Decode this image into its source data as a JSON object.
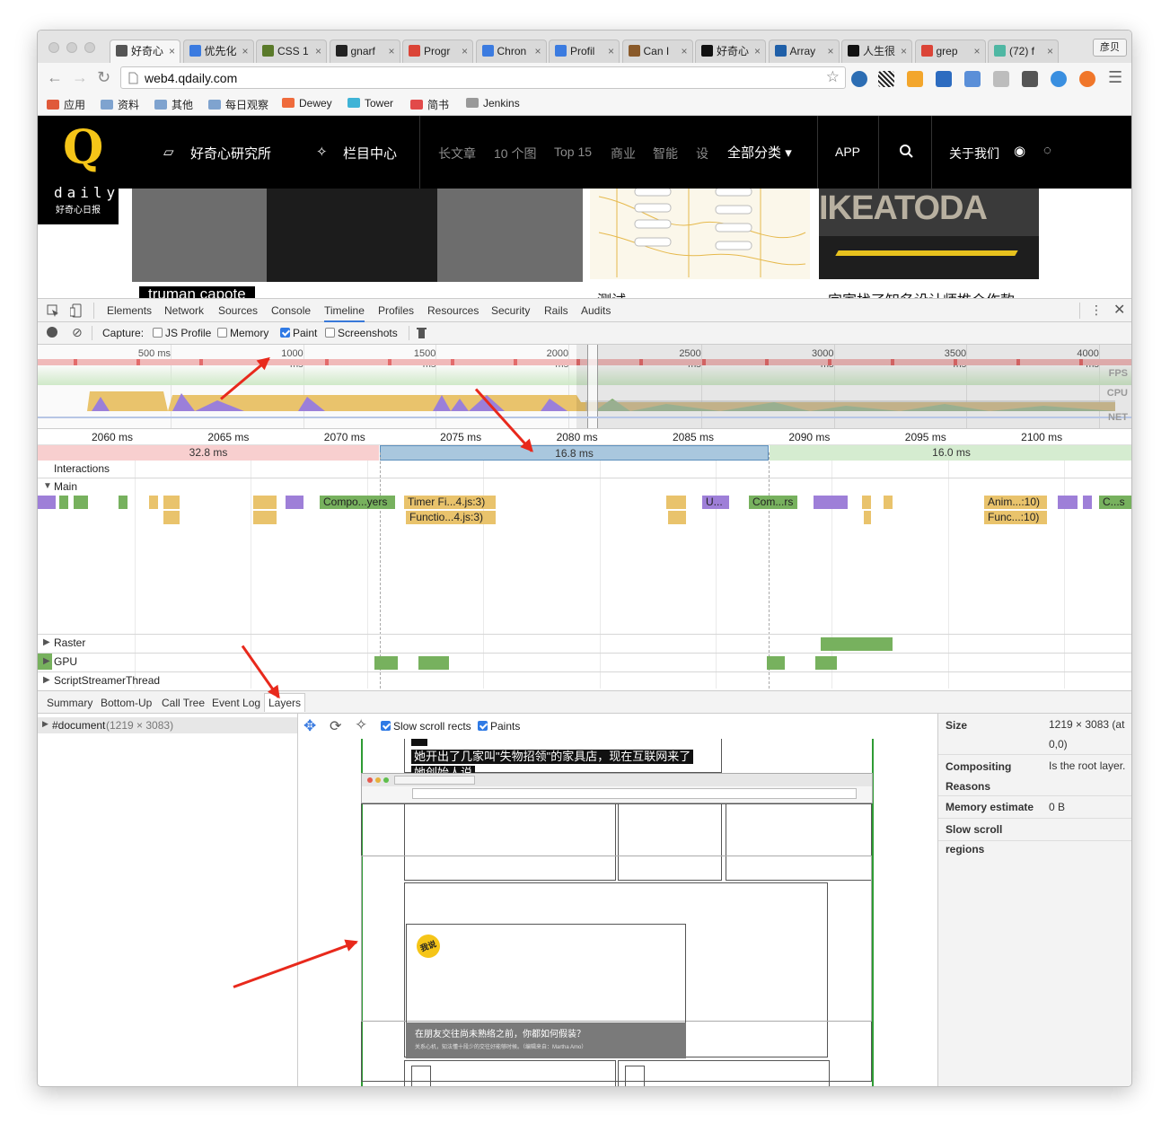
{
  "browser": {
    "tabs": [
      {
        "label": "好奇心",
        "color": "#555"
      },
      {
        "label": "优先化",
        "color": "#3b7be0"
      },
      {
        "label": "CSS 1",
        "color": "#5a7a2a"
      },
      {
        "label": "gnarf",
        "color": "#222"
      },
      {
        "label": "Progr",
        "color": "#db4437"
      },
      {
        "label": "Chron",
        "color": "#3b7be0"
      },
      {
        "label": "Profil",
        "color": "#3b7be0"
      },
      {
        "label": "Can I",
        "color": "#8a5a2a"
      },
      {
        "label": "好奇心",
        "color": "#111"
      },
      {
        "label": "Array",
        "color": "#1f5fa8"
      },
      {
        "label": "人生很",
        "color": "#111"
      },
      {
        "label": "grep",
        "color": "#db4437"
      },
      {
        "label": "(72) f",
        "color": "#4fb7a3"
      }
    ],
    "profile": "彦贝",
    "url": "web4.qdaily.com",
    "bookmarks": [
      "应用",
      "资料",
      "其他",
      "每日观察",
      "Dewey",
      "Tower",
      "简书",
      "Jenkins"
    ]
  },
  "site": {
    "logo_letter": "Q",
    "logo_word": "daily",
    "logo_sub": "好奇心日报",
    "nav_lab": "好奇心研究所",
    "nav_column": "栏目中心",
    "nav_links": [
      "长文章",
      "10 个图",
      "Top 15",
      "商业",
      "智能",
      "设"
    ],
    "nav_all": "全部分类",
    "nav_app": "APP",
    "nav_about": "关于我们",
    "card1_caption": "truman capote",
    "card2_caption": "测试",
    "card3_caption": "宜家找了知名设计师推介作款",
    "card3_sign": "IKEATODA"
  },
  "devtools": {
    "panels": [
      "Elements",
      "Network",
      "Sources",
      "Console",
      "Timeline",
      "Profiles",
      "Resources",
      "Security",
      "Rails",
      "Audits"
    ],
    "selected_panel": "Timeline",
    "capture_label": "Capture:",
    "capture_options": [
      {
        "label": "JS Profile",
        "checked": false
      },
      {
        "label": "Memory",
        "checked": false
      },
      {
        "label": "Paint",
        "checked": true
      },
      {
        "label": "Screenshots",
        "checked": false
      }
    ],
    "overview_ticks": [
      "500 ms",
      "1000 ms",
      "1500 ms",
      "2000 ms",
      "2500 ms",
      "3000 ms",
      "3500 ms",
      "4000 ms"
    ],
    "overview_labels": [
      "FPS",
      "CPU",
      "NET"
    ],
    "ruler_ticks": [
      "2060 ms",
      "2065 ms",
      "2070 ms",
      "2075 ms",
      "2080 ms",
      "2085 ms",
      "2090 ms",
      "2095 ms",
      "2100 ms"
    ],
    "frames": [
      "32.8 ms",
      "16.8 ms",
      "16.0 ms"
    ],
    "tracks": {
      "interactions": "Interactions",
      "main": "Main",
      "raster": "Raster",
      "gpu": "GPU",
      "streamer": "ScriptStreamerThread"
    },
    "events": [
      "Compo...yers",
      "Timer Fi...4.js:3)",
      "Functio...4.js:3)",
      "U...",
      "Com...rs",
      "Anim...:10)",
      "Func...:10)",
      "C...s"
    ],
    "bottom_tabs": [
      "Summary",
      "Bottom-Up",
      "Call Tree",
      "Event Log",
      "Layers"
    ],
    "selected_bottom_tab": "Layers",
    "layer_tree": {
      "name": "#document",
      "size": "(1219 × 3083)"
    },
    "layer_toolbar": [
      {
        "label": "Slow scroll rects",
        "checked": true
      },
      {
        "label": "Paints",
        "checked": true
      }
    ],
    "preview_headline": "她开出了几家叫\"失物招领\"的家具店，现在互联网来了",
    "preview_headline_tail": "她创始人说",
    "preview_badge": "我说",
    "preview_question": "在朋友交往尚未熟络之前，你都如何假装？",
    "preview_question_sub": "关系心机，知法懂十段少的交往好能够时候。（编辑来自：Martha Amo）",
    "properties": [
      {
        "key": "Size",
        "value": "1219 × 3083 (at 0,0)"
      },
      {
        "key": "Compositing Reasons",
        "value": "Is the root layer."
      },
      {
        "key": "Memory estimate",
        "value": "0 B"
      },
      {
        "key": "Slow scroll regions",
        "value": ""
      }
    ]
  }
}
